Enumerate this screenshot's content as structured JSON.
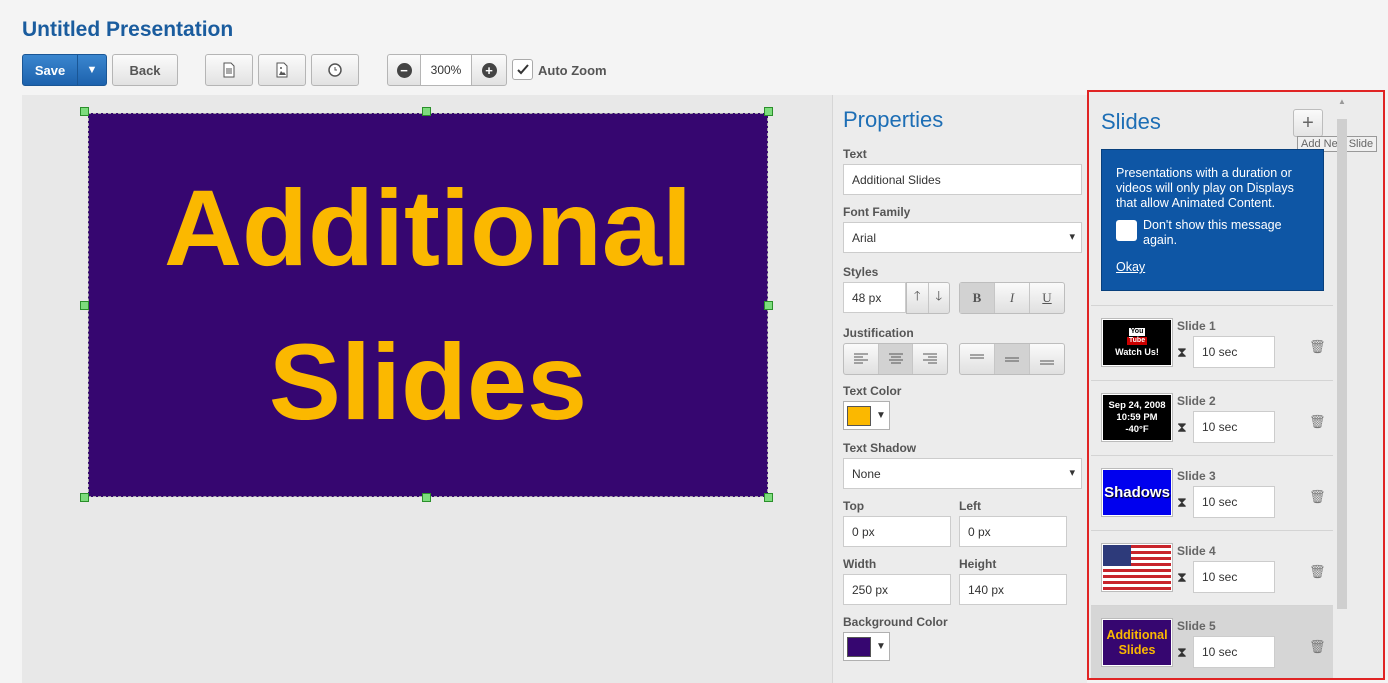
{
  "app": {
    "title": "Untitled Presentation"
  },
  "toolbar": {
    "save_label": "Save",
    "back_label": "Back",
    "zoom_value": "300%",
    "auto_zoom_label": "Auto Zoom",
    "auto_zoom_checked": true
  },
  "canvas": {
    "slide_text_line1": "Additional",
    "slide_text_line2": "Slides",
    "background_color": "#360670",
    "text_color": "#fbb800"
  },
  "properties": {
    "title": "Properties",
    "text_label": "Text",
    "text_value": "Additional Slides",
    "font_family_label": "Font Family",
    "font_family_value": "Arial",
    "styles_label": "Styles",
    "font_size_value": "48 px",
    "bold_label": "B",
    "italic_label": "I",
    "underline_label": "U",
    "justification_label": "Justification",
    "text_color_label": "Text Color",
    "text_color": "#fbb800",
    "text_shadow_label": "Text Shadow",
    "text_shadow_value": "None",
    "top_label": "Top",
    "top_value": "0 px",
    "left_label": "Left",
    "left_value": "0 px",
    "width_label": "Width",
    "width_value": "250 px",
    "height_label": "Height",
    "height_value": "140 px",
    "background_color_label": "Background Color",
    "background_color": "#360670"
  },
  "slides": {
    "title": "Slides",
    "add_label": "+",
    "add_tooltip": "Add New Slide",
    "notice_text": "Presentations with a duration or videos will only play on Displays that allow Animated Content.",
    "notice_checkbox_label": "Don't show this message again.",
    "notice_okay": "Okay",
    "items": [
      {
        "name": "Slide 1",
        "duration": "10 sec",
        "thumb_line1": "You",
        "thumb_line2": "Tube",
        "thumb_line3": "Watch Us!"
      },
      {
        "name": "Slide 2",
        "duration": "10 sec",
        "thumb_line1": "Sep 24, 2008",
        "thumb_line2": "10:59 PM",
        "thumb_line3": "-40°F"
      },
      {
        "name": "Slide 3",
        "duration": "10 sec",
        "thumb_line1": "Shadows"
      },
      {
        "name": "Slide 4",
        "duration": "10 sec"
      },
      {
        "name": "Slide 5",
        "duration": "10 sec",
        "thumb_line1": "Additional",
        "thumb_line2": "Slides"
      }
    ]
  }
}
